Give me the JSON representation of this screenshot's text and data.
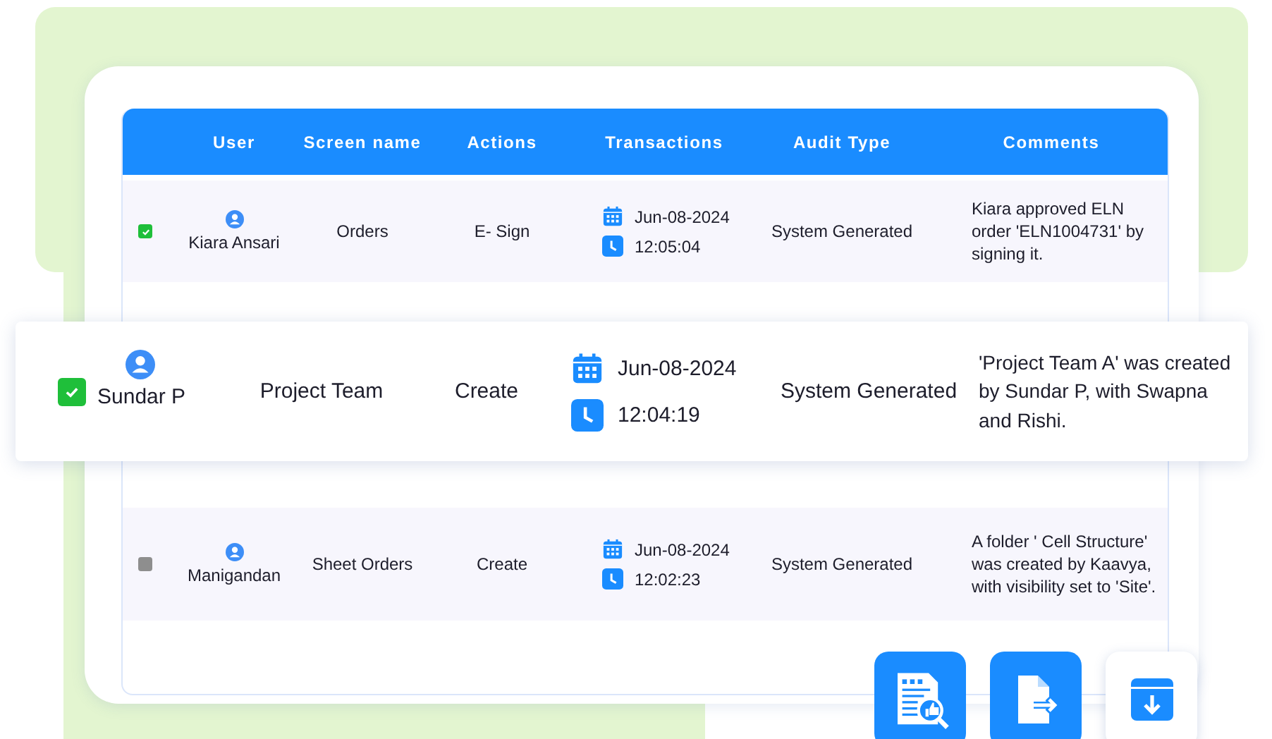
{
  "table": {
    "columns": [
      "User",
      "Screen name",
      "Actions",
      "Transactions",
      "Audit Type",
      "Comments"
    ],
    "rows": [
      {
        "checked": true,
        "highlighted": false,
        "user": "Kiara Ansari",
        "screen": "Orders",
        "action": "E- Sign",
        "date": "Jun-08-2024",
        "time": "12:05:04",
        "audit": "System Generated",
        "comment": "Kiara approved ELN order 'ELN1004731' by signing it."
      },
      {
        "checked": true,
        "highlighted": true,
        "user": "Sundar P",
        "screen": "Project Team",
        "action": "Create",
        "date": "Jun-08-2024",
        "time": "12:04:19",
        "audit": "System Generated",
        "comment": "'Project Team A' was created by Sundar P, with Swapna and Rishi."
      },
      {
        "checked": false,
        "highlighted": false,
        "user": "Manigandan",
        "screen": "Sheet Orders",
        "action": "Create",
        "date": "Jun-08-2024",
        "time": "12:02:23",
        "audit": "System Generated",
        "comment": "A folder ' Cell Structure' was created by Kaavya, with visibility set to 'Site'."
      }
    ]
  },
  "buttons": [
    {
      "kind": "review"
    },
    {
      "kind": "export"
    },
    {
      "kind": "download"
    }
  ]
}
